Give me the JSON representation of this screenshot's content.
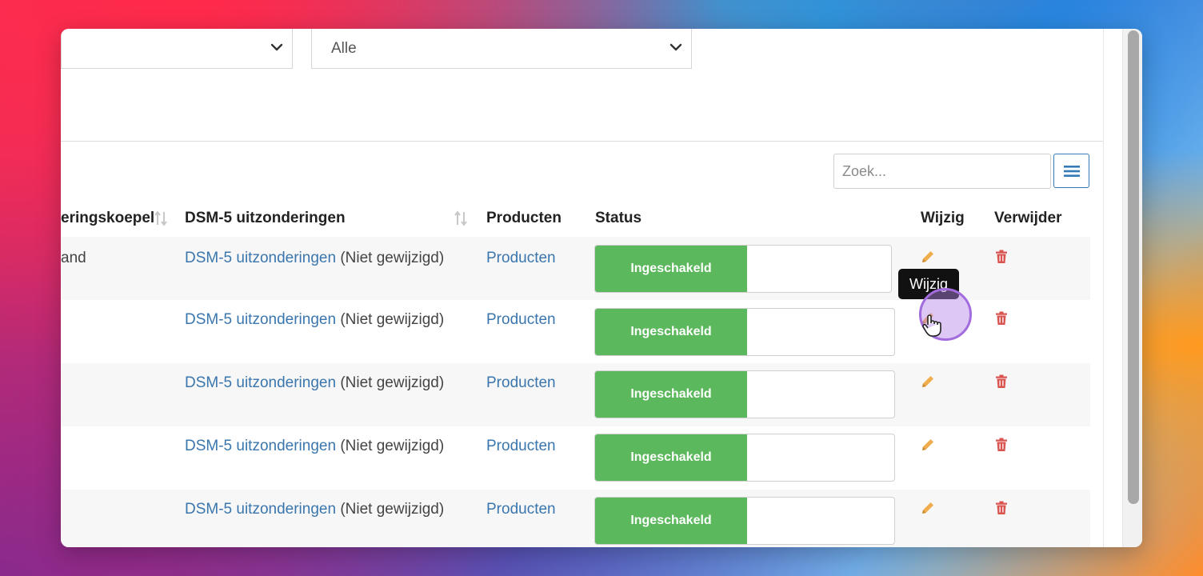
{
  "filters": {
    "first_select_value": "",
    "second_select_value": "Alle"
  },
  "search": {
    "placeholder": "Zoek..."
  },
  "table": {
    "headers": {
      "col_koepel": "eringskoepel",
      "col_dsm": "DSM-5 uitzonderingen",
      "col_producten": "Producten",
      "col_status": "Status",
      "col_wijzig": "Wijzig",
      "col_verwijder": "Verwijder"
    },
    "rows": [
      {
        "koepel": "and",
        "dsm_link": "DSM-5 uitzonderingen",
        "dsm_note": "(Niet gewijzigd)",
        "producten": "Producten",
        "status": "Ingeschakeld"
      },
      {
        "koepel": "",
        "dsm_link": "DSM-5 uitzonderingen",
        "dsm_note": "(Niet gewijzigd)",
        "producten": "Producten",
        "status": "Ingeschakeld"
      },
      {
        "koepel": "",
        "dsm_link": "DSM-5 uitzonderingen",
        "dsm_note": "(Niet gewijzigd)",
        "producten": "Producten",
        "status": "Ingeschakeld"
      },
      {
        "koepel": "",
        "dsm_link": "DSM-5 uitzonderingen",
        "dsm_note": "(Niet gewijzigd)",
        "producten": "Producten",
        "status": "Ingeschakeld"
      },
      {
        "koepel": "",
        "dsm_link": "DSM-5 uitzonderingen",
        "dsm_note": "(Niet gewijzigd)",
        "producten": "Producten",
        "status": "Ingeschakeld"
      }
    ]
  },
  "tooltip": {
    "text": "Wijzig"
  },
  "colors": {
    "enabled_green": "#5cb85c",
    "link_blue": "#3a76ad",
    "edit_orange": "#f0ad4e",
    "delete_red": "#d9534f"
  },
  "icons": {
    "sort": "sort-icon",
    "menu": "hamburger-icon",
    "edit": "pencil-icon",
    "delete": "trash-icon",
    "select": "chevron-down-icon"
  }
}
